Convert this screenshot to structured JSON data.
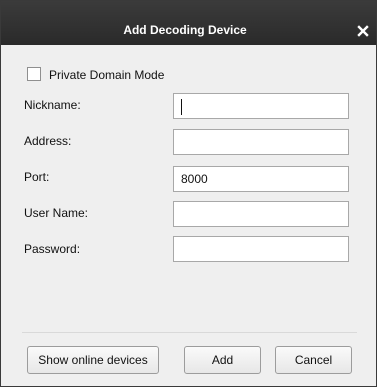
{
  "dialog": {
    "title": "Add Decoding Device",
    "close_icon": "close-icon"
  },
  "options": {
    "private_domain_label": "Private Domain Mode",
    "private_domain_checked": false
  },
  "fields": {
    "nickname": {
      "label": "Nickname:",
      "value": ""
    },
    "address": {
      "label": "Address:",
      "value": ""
    },
    "port": {
      "label": "Port:",
      "value": "8000"
    },
    "username": {
      "label": "User Name:",
      "value": ""
    },
    "password": {
      "label": "Password:",
      "value": ""
    }
  },
  "buttons": {
    "show_online": "Show online devices",
    "add": "Add",
    "cancel": "Cancel"
  }
}
